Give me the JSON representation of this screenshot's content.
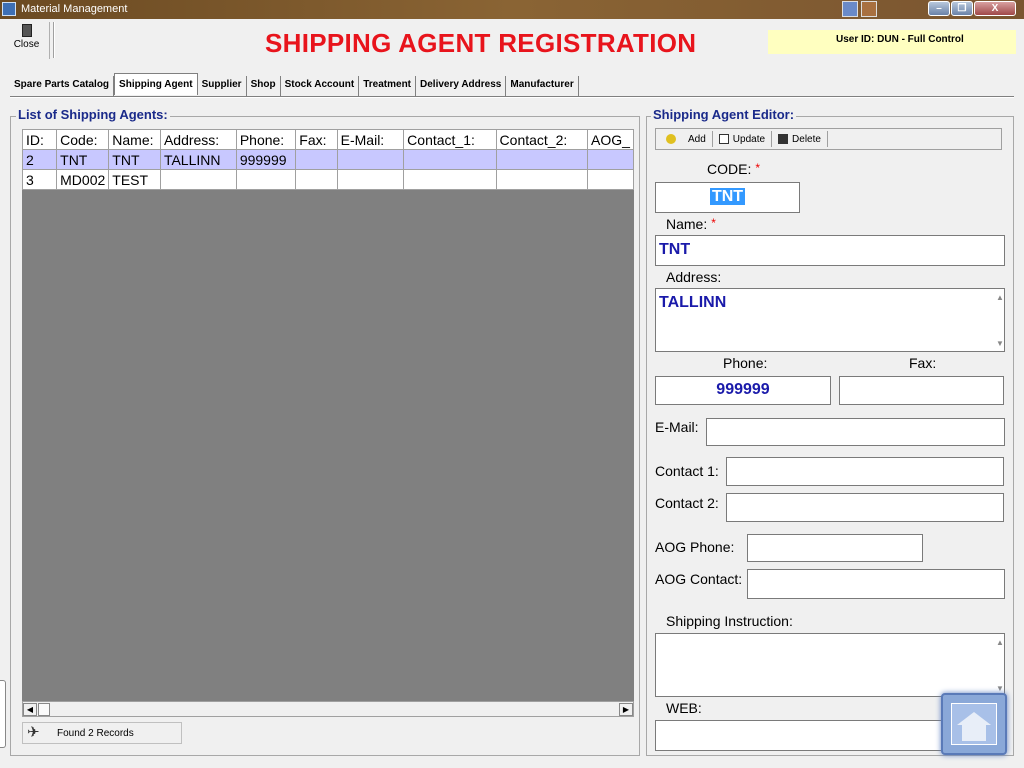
{
  "window": {
    "title": "Material Management"
  },
  "toolbar": {
    "close_label": "Close",
    "page_title": "SHIPPING AGENT REGISTRATION",
    "user_info": "User ID: DUN - Full Control"
  },
  "tabs": [
    {
      "label": "Spare Parts Catalog"
    },
    {
      "label": "Shipping Agent"
    },
    {
      "label": "Supplier"
    },
    {
      "label": "Shop"
    },
    {
      "label": "Stock Account"
    },
    {
      "label": "Treatment"
    },
    {
      "label": "Delivery Address"
    },
    {
      "label": "Manufacturer"
    }
  ],
  "list": {
    "title": "List of Shipping Agents:",
    "columns": [
      "ID:",
      "Code:",
      "Name:",
      "Address:",
      "Phone:",
      "Fax:",
      "E-Mail:",
      "Contact_1:",
      "Contact_2:",
      "AOG_"
    ],
    "rows": [
      [
        "2",
        "TNT",
        "TNT",
        "TALLINN",
        "999999",
        "",
        "",
        "",
        "",
        ""
      ],
      [
        "3",
        "MD002",
        "TEST",
        "",
        "",
        "",
        "",
        "",
        "",
        ""
      ]
    ],
    "status": "Found 2 Records"
  },
  "editor": {
    "title": "Shipping Agent Editor:",
    "add_label": "Add",
    "update_label": "Update",
    "delete_label": "Delete",
    "code_label": "CODE:",
    "code_value": "TNT",
    "required_mark": "*",
    "name_label": "Name:",
    "name_value": "TNT",
    "address_label": "Address:",
    "address_value": "TALLINN",
    "phone_label": "Phone:",
    "phone_value": "999999",
    "fax_label": "Fax:",
    "fax_value": "",
    "email_label": "E-Mail:",
    "email_value": "",
    "contact1_label": "Contact 1:",
    "contact1_value": "",
    "contact2_label": "Contact 2:",
    "contact2_value": "",
    "aog_phone_label": "AOG Phone:",
    "aog_phone_value": "",
    "aog_contact_label": "AOG Contact:",
    "aog_contact_value": "",
    "shipping_instruction_label": "Shipping Instruction:",
    "shipping_instruction_value": "",
    "web_label": "WEB:",
    "web_value": ""
  },
  "colors": {
    "title_red": "#e8141c",
    "group_title_blue": "#1a2a8a",
    "selected_row": "#c8c8ff",
    "field_text": "#1a1aaa",
    "user_box": "#ffffc0"
  },
  "icons": {
    "app": "app-icon",
    "close": "door-exit-icon",
    "add": "add-icon",
    "update": "update-icon",
    "delete": "trash-icon",
    "status": "airplane-icon",
    "nav": "home-icon"
  }
}
